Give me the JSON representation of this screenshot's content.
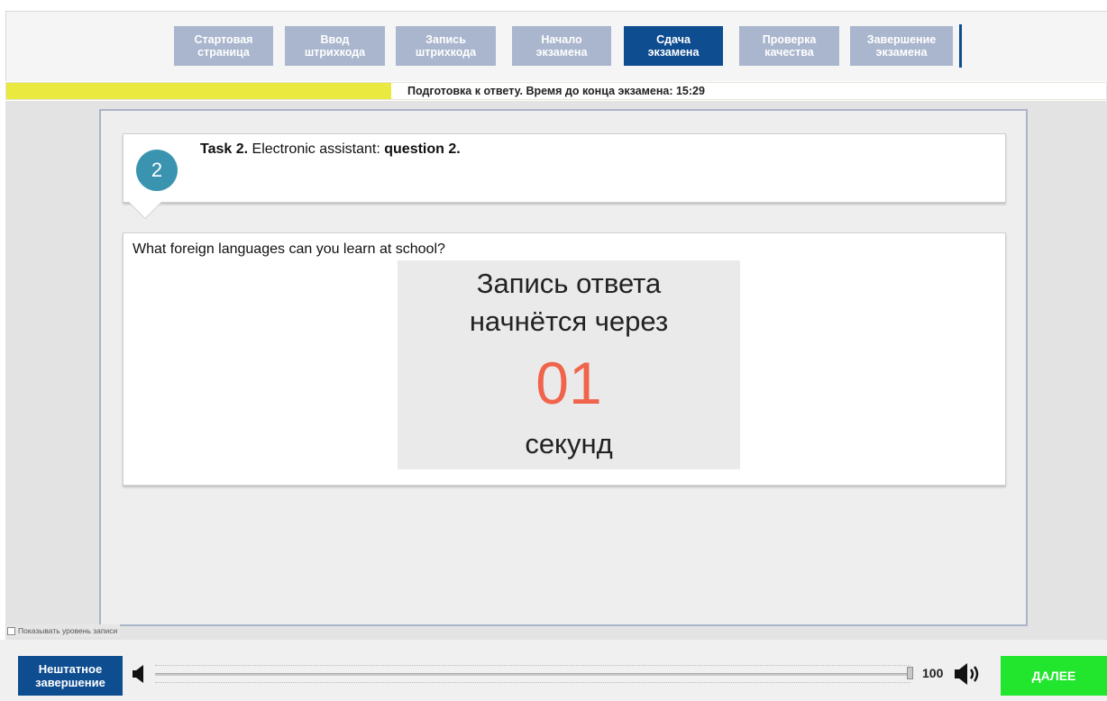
{
  "steps": [
    {
      "label": "Стартовая\nстраница",
      "active": false
    },
    {
      "label": "Ввод\nштрихкода",
      "active": false
    },
    {
      "label": "Запись\nштрихкода",
      "active": false
    },
    {
      "label": "Начало\nэкзамена",
      "active": false
    },
    {
      "label": "Сдача\nэкзамена",
      "active": true
    },
    {
      "label": "Проверка\nкачества",
      "active": false
    },
    {
      "label": "Завершение\nэкзамена",
      "active": false
    }
  ],
  "status": {
    "text": "Подготовка к ответу. Время до конца экзамена: 15:29",
    "progress_fraction": 0.35
  },
  "task": {
    "number": "2",
    "title_bold": "Task 2.",
    "title_normal": " Electronic assistant: ",
    "title_tail_bold": "question 2."
  },
  "question": {
    "text": "What foreign languages can you learn at school?"
  },
  "countdown": {
    "line1": "Запись ответа",
    "line2": "начнётся через",
    "value": "01",
    "unit": "секунд"
  },
  "show_level": {
    "label": "Показывать уровень записи",
    "checked": false
  },
  "bottom": {
    "abort_label": "Нештатное\nзавершение",
    "volume": "100",
    "volume_fraction": 1.0,
    "next_label": "ДАЛЕЕ"
  },
  "colors": {
    "step_inactive": "#a9b6cd",
    "step_active": "#0f4d91",
    "status_fill": "#e9e93f",
    "task_badge": "#3a94b0",
    "countdown_value": "#f0644c",
    "next_button": "#22e52d",
    "abort_button": "#0f4d91"
  },
  "icons": {
    "volume_min": "speaker-icon",
    "volume_max": "speaker-loud-icon"
  }
}
